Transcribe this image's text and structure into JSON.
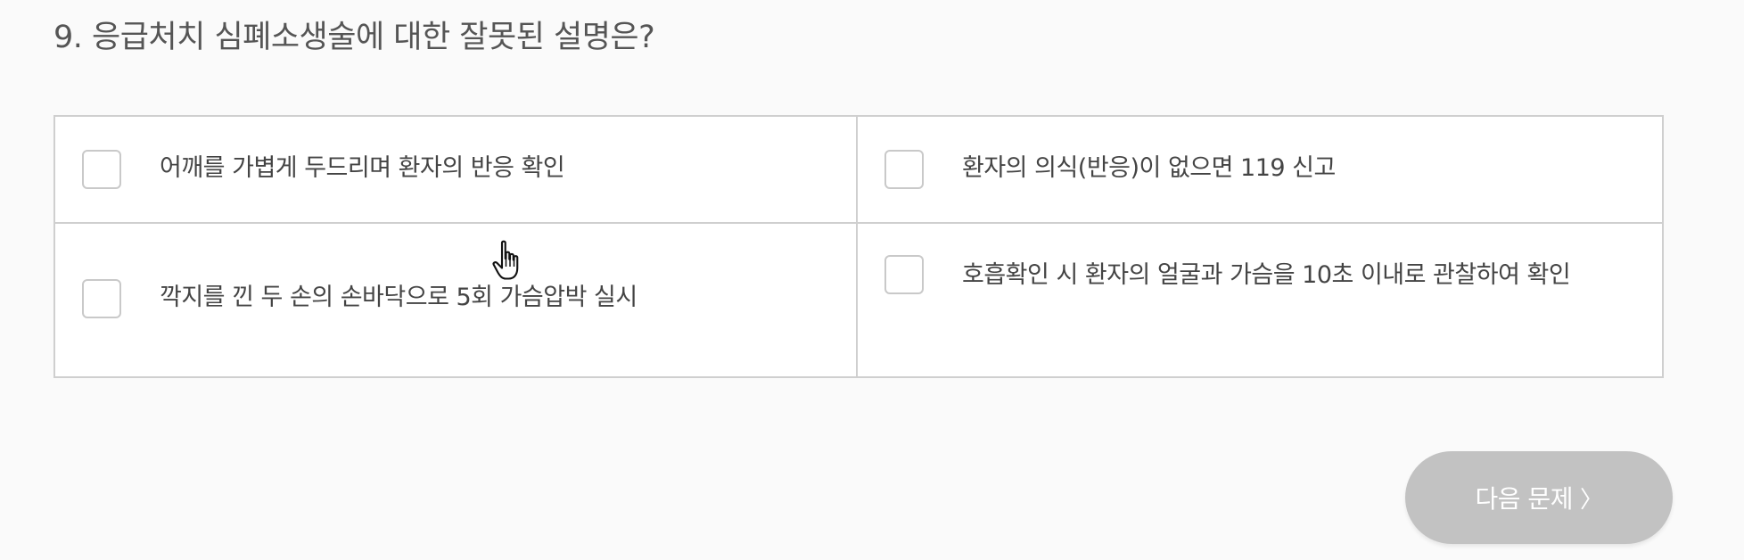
{
  "question": {
    "title": "9. 응급처치 심폐소생술에 대한 잘못된 설명은?"
  },
  "options": [
    {
      "label": "어깨를 가볍게 두드리며 환자의 반응 확인",
      "checked": false
    },
    {
      "label": "환자의 의식(반응)이 없으면 119 신고",
      "checked": false
    },
    {
      "label": "깍지를 낀 두 손의 손바닥으로 5회 가슴압박 실시",
      "checked": false
    },
    {
      "label": "호흡확인 시 환자의 얼굴과 가슴을 10초 이내로 관찰하여 확인",
      "checked": false
    }
  ],
  "next_button": {
    "label": "다음 문제",
    "chevron": "〉",
    "state": "disabled"
  },
  "icons": {
    "cursor": "hand-pointer-icon"
  },
  "colors": {
    "border": "#cfcfcf",
    "button_bg": "#c2c2c2",
    "title_text": "#555555"
  }
}
